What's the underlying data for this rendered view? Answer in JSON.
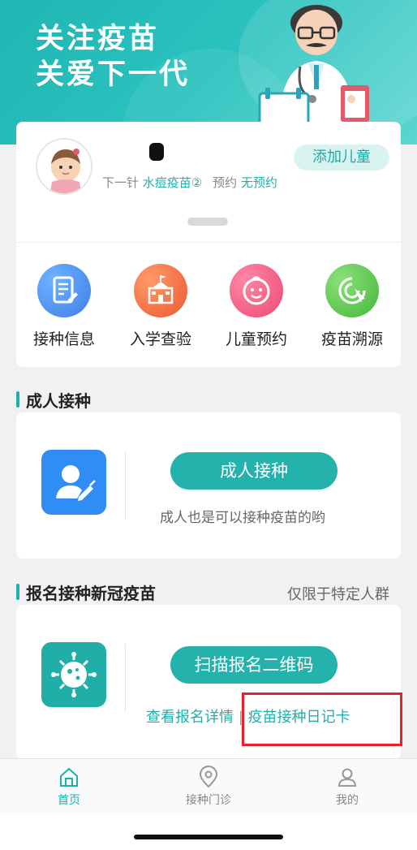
{
  "banner": {
    "title_line1": "关注疫苗",
    "title_line2": "关爱下一代"
  },
  "child": {
    "add_child_label": "添加儿童",
    "next_prefix": "下一针",
    "next_vaccine": "水痘疫苗②",
    "appointment_label": "预约",
    "appointment_status": "无预约"
  },
  "quick_actions": [
    {
      "label": "接种信息",
      "icon": "document-edit-icon",
      "color": "#4a90f0"
    },
    {
      "label": "入学查验",
      "icon": "school-icon",
      "color": "#f26b3a"
    },
    {
      "label": "儿童预约",
      "icon": "baby-face-icon",
      "color": "#f0567f"
    },
    {
      "label": "疫苗溯源",
      "icon": "trace-icon",
      "color": "#5bc84e"
    }
  ],
  "adult": {
    "section_title": "成人接种",
    "button_label": "成人接种",
    "subtext": "成人也是可以接种疫苗的哟"
  },
  "covid": {
    "section_title": "报名接种新冠疫苗",
    "section_note": "仅限于特定人群",
    "button_label": "扫描报名二维码",
    "link_details": "查看报名详情",
    "separator": "|",
    "link_diary": "疫苗接种日记卡"
  },
  "tabbar": {
    "home": "首页",
    "clinic": "接种门诊",
    "me": "我的"
  },
  "colors": {
    "accent": "#1fb0ad",
    "highlight": "#e8222a"
  }
}
